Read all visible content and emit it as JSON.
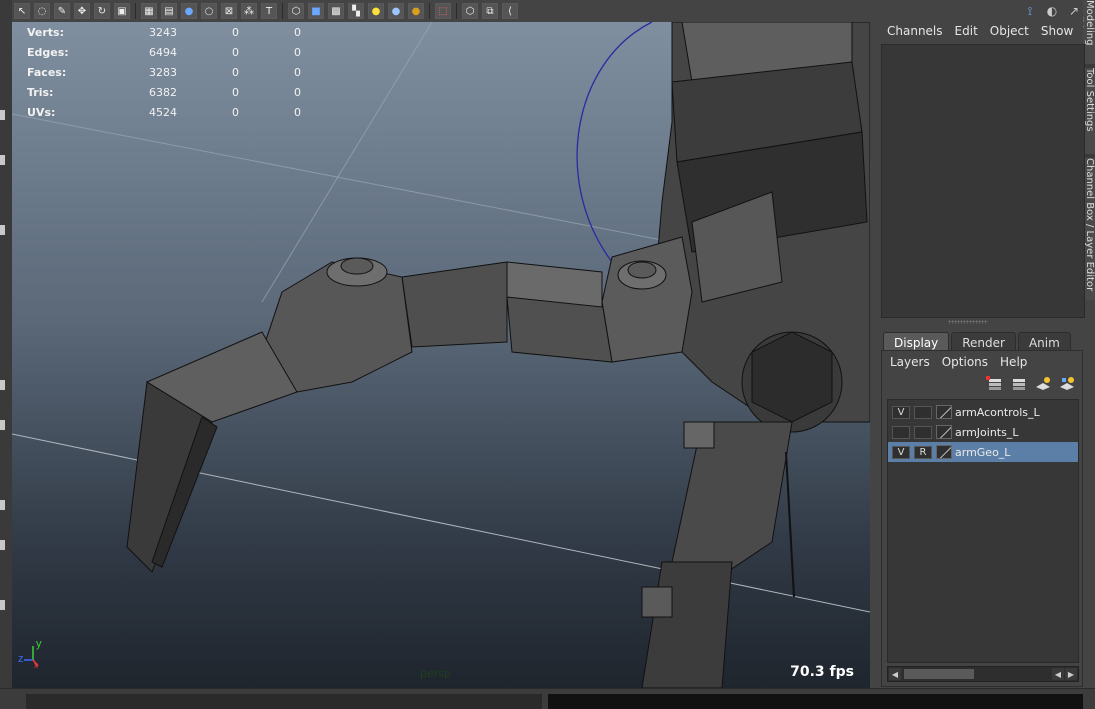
{
  "toolbar": {
    "icons": [
      "select-tool-icon",
      "lasso-icon",
      "paint-select-icon",
      "move-tool-icon",
      "rotate-tool-icon",
      "scale-tool-icon",
      "wireframe-icon",
      "grid-icon",
      "smooth-shade-icon",
      "default-material-icon",
      "xray-icon",
      "isolate-icon",
      "text-icon",
      "cube-icon",
      "shaded-cube-icon",
      "textured-cube-icon",
      "checker-icon",
      "light-icon",
      "sphere-icon",
      "gold-sphere-icon",
      "camera-select-icon",
      "cube-wire-icon",
      "cube-duplicate-icon",
      "share-icon"
    ]
  },
  "hud": {
    "rows": [
      {
        "label": "Verts:",
        "value": "3243",
        "a": "0",
        "b": "0"
      },
      {
        "label": "Edges:",
        "value": "6494",
        "a": "0",
        "b": "0"
      },
      {
        "label": "Faces:",
        "value": "3283",
        "a": "0",
        "b": "0"
      },
      {
        "label": "Tris:",
        "value": "6382",
        "a": "0",
        "b": "0"
      },
      {
        "label": "UVs:",
        "value": "4524",
        "a": "0",
        "b": "0"
      }
    ]
  },
  "viewport": {
    "camera": "persp",
    "fps": "70.3 fps",
    "axis_y": "y",
    "axis_z": "z",
    "axis_x": "x"
  },
  "channel_box": {
    "menu": [
      "Channels",
      "Edit",
      "Object",
      "Show"
    ]
  },
  "side_tabs": [
    "Modeling Toolkit",
    "Tool Settings",
    "Channel Box / Layer Editor"
  ],
  "layer_editor": {
    "tabs": [
      "Display",
      "Render",
      "Anim"
    ],
    "active_tab": "Display",
    "menu": [
      "Layers",
      "Options",
      "Help"
    ],
    "layers": [
      {
        "v": "V",
        "r": "",
        "name": "armAcontrols_L",
        "selected": false
      },
      {
        "v": "",
        "r": "",
        "name": "armJoints_L",
        "selected": false
      },
      {
        "v": "V",
        "r": "R",
        "name": "armGeo_L",
        "selected": true
      }
    ]
  },
  "colors": {
    "selected_layer": "#5b7fa6",
    "viewport_top": "#7f8fa0",
    "viewport_bottom": "#1f252d"
  }
}
